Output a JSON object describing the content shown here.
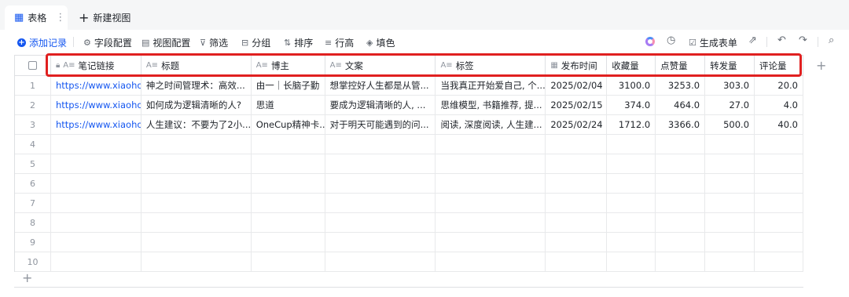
{
  "tabs": {
    "active_label": "表格",
    "new_view_label": "新建视图"
  },
  "toolbar": {
    "add_record": "添加记录",
    "field_config": "字段配置",
    "view_config": "视图配置",
    "filter": "筛选",
    "group": "分组",
    "sort": "排序",
    "row_height": "行高",
    "fill_color": "填色",
    "generate_form": "生成表单"
  },
  "columns": [
    "笔记链接",
    "标题",
    "博主",
    "文案",
    "标签",
    "发布时间",
    "收藏量",
    "点赞量",
    "转发量",
    "评论量"
  ],
  "rows": [
    {
      "n": "1",
      "link": "https://www.xiaoho...",
      "title": "神之时间管理术：高效...",
      "author": "由一｜长脑子勤",
      "copy": "想掌控好人生都是从管...",
      "tags": "当我真正开始爱自己, 个...",
      "date": "2025/02/04",
      "fav": "3100.0",
      "like": "3253.0",
      "share": "303.0",
      "comment": "20.0"
    },
    {
      "n": "2",
      "link": "https://www.xiaoho...",
      "title": "如何成为逻辑清晰的人?",
      "author": "思道",
      "copy": "要成为逻辑清晰的人, ...",
      "tags": "思维模型, 书籍推荐, 提...",
      "date": "2025/02/15",
      "fav": "374.0",
      "like": "464.0",
      "share": "27.0",
      "comment": "4.0"
    },
    {
      "n": "3",
      "link": "https://www.xiaoho...",
      "title": "人生建议：不要为了2小...",
      "author": "OneCup精神卡...",
      "copy": "对于明天可能遇到的问...",
      "tags": "阅读, 深度阅读, 人生建...",
      "date": "2025/02/24",
      "fav": "1712.0",
      "like": "3366.0",
      "share": "500.0",
      "comment": "40.0"
    }
  ],
  "empty_rows": [
    "4",
    "5",
    "6",
    "7",
    "8",
    "9",
    "10"
  ],
  "colors": {
    "accent": "#1456f0",
    "highlight_border": "#e02020"
  }
}
